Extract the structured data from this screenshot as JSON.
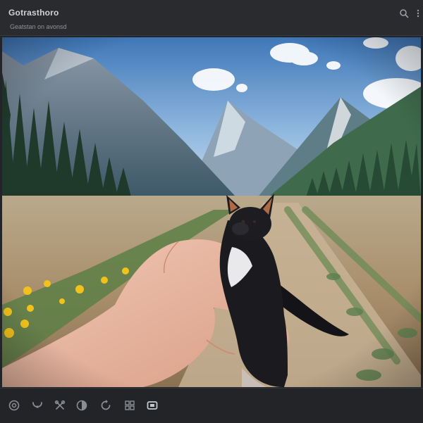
{
  "window": {
    "title": "Gotrasthoro",
    "subtitle": "Geatstan on avonsd"
  },
  "titlebar_icons": [
    "search-icon",
    "more-vertical-icon"
  ],
  "photo": {
    "scene": "mountain-valley-field",
    "subject": "small-black-and-white-fox-held-in-hand"
  },
  "toolbar": {
    "tools": [
      "rotate-icon",
      "face-icon",
      "link-icon",
      "adjust-icon",
      "refresh-icon",
      "grid-icon",
      "crop-icon"
    ]
  },
  "colors": {
    "background": "#232427",
    "titlebar": "#2a2b2e",
    "text": "#cfd2d6",
    "icon": "#8a8e94"
  }
}
